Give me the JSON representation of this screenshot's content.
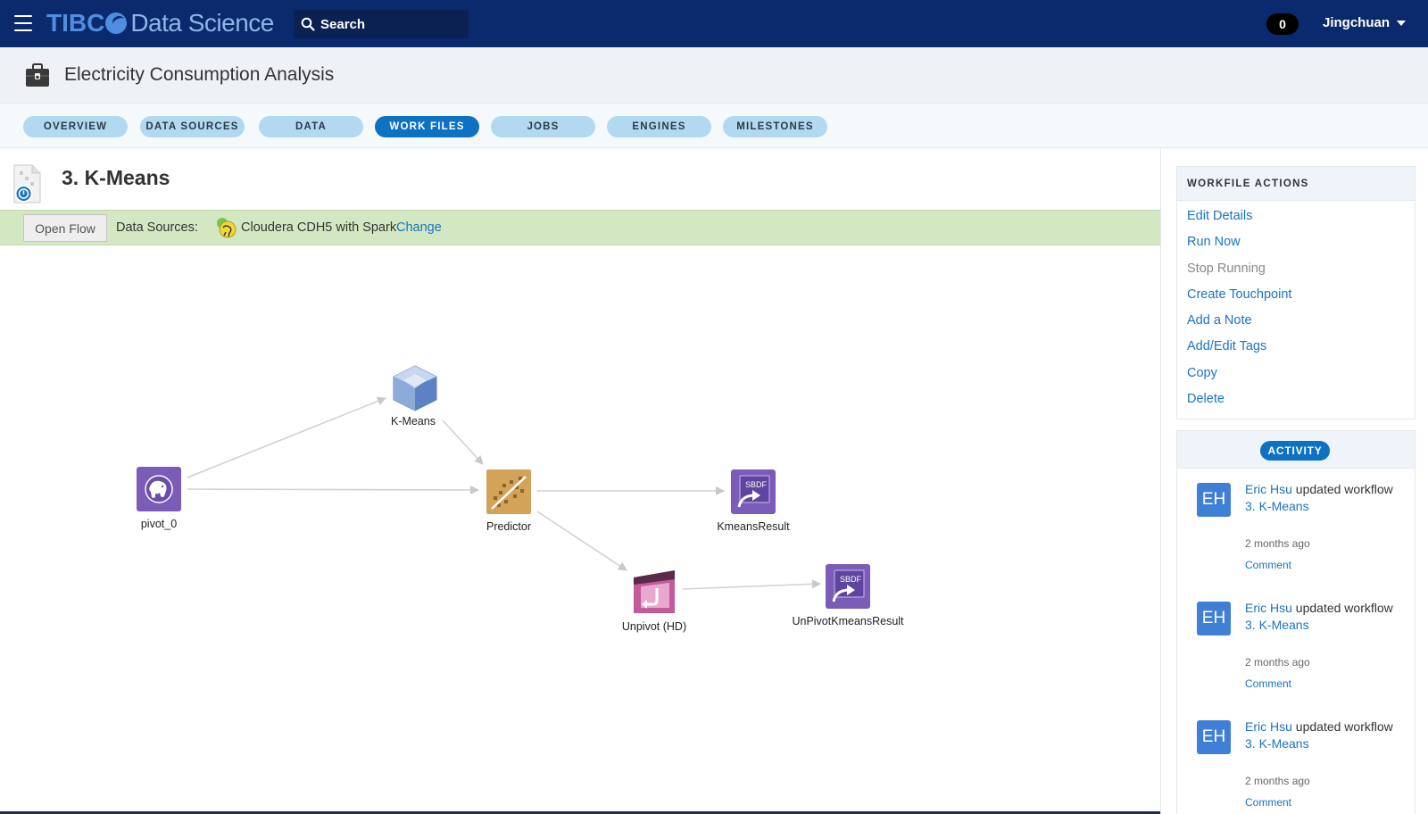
{
  "app": {
    "brand_primary": "TIBC",
    "brand_secondary": "Data Science",
    "search_placeholder": "Search",
    "notification_count": "0",
    "user_name": "Jingchuan"
  },
  "workspace": {
    "title": "Electricity Consumption Analysis"
  },
  "tabs": [
    {
      "label": "OVERVIEW",
      "active": false
    },
    {
      "label": "DATA SOURCES",
      "active": false
    },
    {
      "label": "DATA",
      "active": false
    },
    {
      "label": "WORK FILES",
      "active": true
    },
    {
      "label": "JOBS",
      "active": false
    },
    {
      "label": "ENGINES",
      "active": false
    },
    {
      "label": "MILESTONES",
      "active": false
    }
  ],
  "workfile": {
    "title": "3. K-Means",
    "open_flow_label": "Open Flow",
    "data_sources_label": "Data Sources:",
    "data_source_name": "Cloudera CDH5 with Spark",
    "change_label": "Change"
  },
  "flow": {
    "nodes": [
      {
        "id": "pivot",
        "label": "pivot_0",
        "icon": "hadoop-dataset-icon"
      },
      {
        "id": "kmeans",
        "label": "K-Means",
        "icon": "kmeans-hexagon-icon"
      },
      {
        "id": "predictor",
        "label": "Predictor",
        "icon": "predictor-icon"
      },
      {
        "id": "kmeansresult",
        "label": "KmeansResult",
        "icon": "sbdf-export-icon",
        "badge": "SBDF"
      },
      {
        "id": "unpivot",
        "label": "Unpivot (HD)",
        "icon": "unpivot-icon"
      },
      {
        "id": "unpivotresult",
        "label": "UnPivotKmeansResult",
        "icon": "sbdf-export-icon",
        "badge": "SBDF"
      }
    ]
  },
  "actions": {
    "title": "WORKFILE ACTIONS",
    "items": [
      {
        "label": "Edit Details",
        "enabled": true
      },
      {
        "label": "Run Now",
        "enabled": true
      },
      {
        "label": "Stop Running",
        "enabled": false
      },
      {
        "label": "Create Touchpoint",
        "enabled": true
      },
      {
        "label": "Add a Note",
        "enabled": true
      },
      {
        "label": "Add/Edit Tags",
        "enabled": true
      },
      {
        "label": "Copy",
        "enabled": true
      },
      {
        "label": "Delete",
        "enabled": true
      }
    ]
  },
  "activity": {
    "title": "ACTIVITY",
    "items": [
      {
        "initials": "EH",
        "user": "Eric Hsu",
        "action": "updated workflow",
        "target": "3. K-Means",
        "time": "2 months ago",
        "comment_label": "Comment"
      },
      {
        "initials": "EH",
        "user": "Eric Hsu",
        "action": "updated workflow",
        "target": "3. K-Means",
        "time": "2 months ago",
        "comment_label": "Comment"
      },
      {
        "initials": "EH",
        "user": "Eric Hsu",
        "action": "updated workflow",
        "target": "3. K-Means",
        "time": "2 months ago",
        "comment_label": "Comment"
      }
    ]
  },
  "colors": {
    "topbar": "#0b2a6e",
    "accent": "#0d71c4",
    "tab_inactive": "#b3d9f0",
    "link": "#1a73c4",
    "datasource_bar": "#d3e8c2",
    "node_purple": "#7b5cb8",
    "node_gold": "#d4a35a",
    "node_pink": "#c45a9a",
    "avatar": "#3f7fd6"
  }
}
